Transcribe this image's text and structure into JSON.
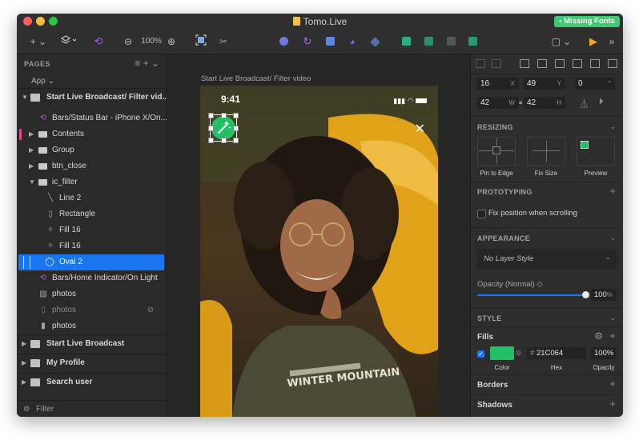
{
  "window": {
    "title": "Tomo.Live",
    "missing_fonts": "• Missing Fonts",
    "traffic_colors": [
      "#ff5f57",
      "#febc2e",
      "#28c840"
    ]
  },
  "toolbar": {
    "insert_label": "+ ⌄",
    "zoom_out": "⊖",
    "zoom_level": "100%",
    "zoom_in": "⊕",
    "view_label": "▢ ⌄",
    "more_label": "»"
  },
  "sidebar": {
    "pages_header": "PAGES",
    "app_label": "App ⌄",
    "page_current": "Start Live Broadcast/ Filter vid...",
    "layers": [
      {
        "label": "Bars/Status Bar - iPhone X/On...",
        "icon": "symbol-icon"
      },
      {
        "label": "Contents",
        "icon": "folder-icon"
      },
      {
        "label": "Group",
        "icon": "folder-icon"
      },
      {
        "label": "btn_close",
        "icon": "folder-icon"
      },
      {
        "label": "ic_filter",
        "icon": "folder-icon"
      },
      {
        "label": "Line 2",
        "icon": "line-icon"
      },
      {
        "label": "Rectangle",
        "icon": "rectangle-icon"
      },
      {
        "label": "Fill 16",
        "icon": "path-icon"
      },
      {
        "label": "Fill 16",
        "icon": "path-icon"
      },
      {
        "label": "Oval 2",
        "icon": "oval-icon"
      },
      {
        "label": "Bars/Home Indicator/On Light",
        "icon": "symbol-icon"
      },
      {
        "label": "photos",
        "icon": "image-icon"
      },
      {
        "label": "photos",
        "icon": "image-icon"
      },
      {
        "label": "photos",
        "icon": "rectangle-icon"
      }
    ],
    "other_pages": [
      "Start Live Broadcast",
      "My Profile",
      "Search user"
    ],
    "filter_label": "Filter"
  },
  "canvas": {
    "artboard_label": "Start Live Broadcast/ Filter video",
    "status_time": "9:41",
    "close_glyph": "✕",
    "shirt_text": "WINTER MOUNTAIN"
  },
  "inspector": {
    "x": "16",
    "y": "49",
    "rotation": "0",
    "w": "42",
    "h": "42",
    "x_sub": "X",
    "y_sub": "Y",
    "deg_sub": "°",
    "w_sub": "W",
    "h_sub": "H",
    "resizing_header": "RESIZING",
    "pin_to_edge": "Pin to Edge",
    "fix_size": "Fix Size",
    "preview": "Preview",
    "prototyping_header": "PROTOTYPING",
    "fix_position": "Fix position when scrolling",
    "appearance_header": "APPEARANCE",
    "layer_style": "No Layer Style",
    "opacity_label": "Opacity (Normal) ◇",
    "opacity_value": "100",
    "opacity_fraction": 1.0,
    "percent_sign": "%",
    "style_header": "STYLE",
    "fills_label": "Fills",
    "fill_hex": "21C064",
    "fill_color": "#21c064",
    "fill_opacity": "100%",
    "color_caption": "Color",
    "hex_caption": "Hex",
    "opacity_caption": "Opacity",
    "borders_label": "Borders",
    "shadows_label": "Shadows"
  },
  "colors": {
    "accent_blue": "#1a76f0",
    "selection_pink": "#e24a8a",
    "play_orange": "#f5a623"
  }
}
